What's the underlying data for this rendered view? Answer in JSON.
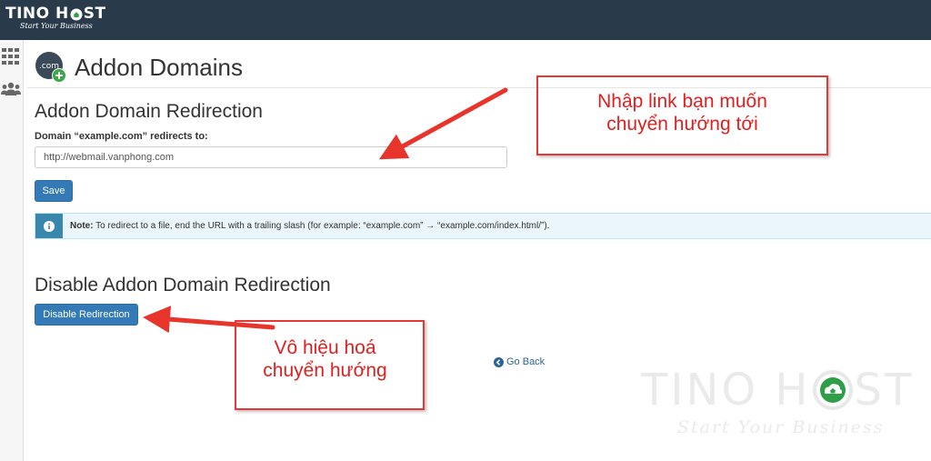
{
  "brand": {
    "logo_before": "TINO H",
    "logo_after": "ST",
    "tagline": "Start Your Business"
  },
  "header": {
    "icon_text": ".com",
    "title": "Addon Domains"
  },
  "redirection": {
    "section_title": "Addon Domain Redirection",
    "field_label": "Domain “example.com” redirects to:",
    "input_value": "http://webmail.vanphong.com",
    "save_label": "Save"
  },
  "note": {
    "label": "Note:",
    "text": " To redirect to a file, end the URL with a trailing slash (for example: “example.com” → “example.com/index.html/”)."
  },
  "disable": {
    "section_title": "Disable Addon Domain Redirection",
    "button_label": "Disable Redirection"
  },
  "go_back": {
    "label": "Go Back"
  },
  "annotations": {
    "input_hint_line1": "Nhập link bạn muốn",
    "input_hint_line2": "chuyển hướng tới",
    "disable_hint_line1": "Vô hiệu hoá",
    "disable_hint_line2": "chuyển hướng"
  },
  "watermark": {
    "text_before": "TINO H",
    "text_after": "ST",
    "tagline": "Start Your Business"
  },
  "colors": {
    "topbar": "#293a4a",
    "primary_button": "#337ab7",
    "info_bg": "#eaf6fb",
    "annotation_red": "#e53935"
  },
  "icons": {
    "sidebar": [
      "grid-icon",
      "users-icon"
    ],
    "header": "addon-domain-icon",
    "note": "info-icon",
    "go_back": "arrow-left-circle-icon"
  }
}
